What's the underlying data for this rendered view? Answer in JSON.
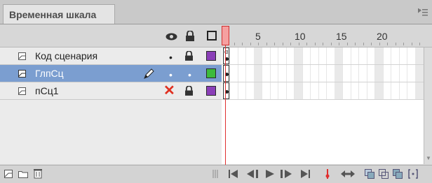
{
  "tab": {
    "title": "Временная шкала"
  },
  "ruler": {
    "labels": [
      "5",
      "10",
      "15",
      "20"
    ]
  },
  "layers": [
    {
      "name": "Код сценария",
      "selected": false,
      "visibility": "•",
      "color": "#8b3fb8",
      "color_fill": true
    },
    {
      "name": "ГлпСц",
      "selected": true,
      "visibility": "•",
      "lock": "•",
      "color": "#3dbb3d",
      "color_fill": true
    },
    {
      "name": "пСц1",
      "selected": false,
      "visibility": "✕",
      "color": "#8b3fb8",
      "color_fill": true
    }
  ],
  "colors": {
    "selection": "#7b9ed0",
    "playhead": "#e03030",
    "outline_purple": "#8b3fb8",
    "outline_green": "#3dbb3d"
  },
  "icons": {
    "panel_menu": "panel-menu-icon",
    "bottom_left": [
      "new-layer-icon",
      "new-folder-icon",
      "delete-icon"
    ],
    "playback": [
      "go-to-first-frame-icon",
      "step-back-icon",
      "play-icon",
      "step-forward-icon",
      "go-to-last-frame-icon"
    ],
    "onion": [
      "center-frame-icon",
      "loop-icon",
      "onion-skin-icon",
      "onion-skin-outlines-icon",
      "edit-multiple-frames-icon",
      "modify-markers-icon"
    ]
  }
}
